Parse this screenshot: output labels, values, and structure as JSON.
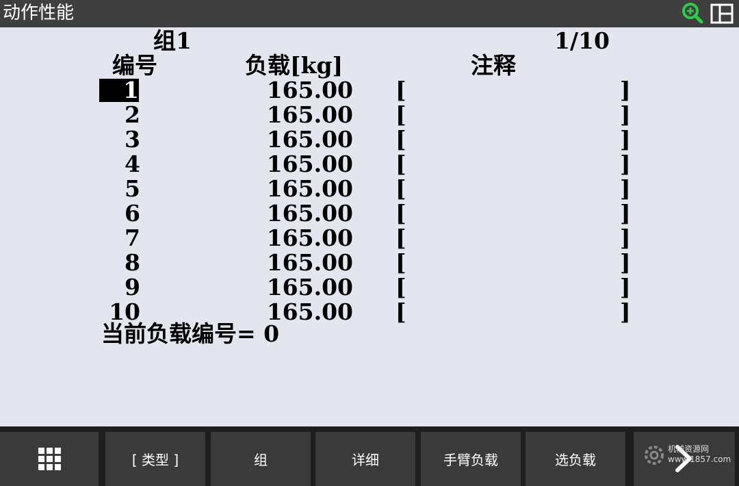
{
  "title": "动作性能",
  "icons": {
    "zoom": "zoom-in-icon",
    "layout": "split-layout-icon",
    "menu": "grid-menu-icon",
    "next": "next-page-icon"
  },
  "colors": {
    "titlebar_bg": "#3f3f3f",
    "content_bg": "#e3e6ee",
    "fkey_bg": "#3a3a3a",
    "zoom_icon": "#31c94a"
  },
  "group": "组1",
  "page_indicator": "1/10",
  "headers": {
    "number": "编号",
    "load": "负载[kg]",
    "comment": "注释"
  },
  "rows": [
    {
      "num": "1",
      "load": "165.00",
      "comment": ""
    },
    {
      "num": "2",
      "load": "165.00",
      "comment": ""
    },
    {
      "num": "3",
      "load": "165.00",
      "comment": ""
    },
    {
      "num": "4",
      "load": "165.00",
      "comment": ""
    },
    {
      "num": "5",
      "load": "165.00",
      "comment": ""
    },
    {
      "num": "6",
      "load": "165.00",
      "comment": ""
    },
    {
      "num": "7",
      "load": "165.00",
      "comment": ""
    },
    {
      "num": "8",
      "load": "165.00",
      "comment": ""
    },
    {
      "num": "9",
      "load": "165.00",
      "comment": ""
    },
    {
      "num": "10",
      "load": "165.00",
      "comment": ""
    }
  ],
  "bracket_open": "[",
  "bracket_close": "]",
  "current_load_label": "当前负载编号=",
  "current_load_value": "0",
  "fkeys": {
    "type": "[ 类型 ]",
    "group": "组",
    "detail": "详细",
    "arm_load": "手臂负载",
    "select_load": "选负载"
  },
  "watermark": {
    "line1": "机械资源网",
    "line2": "www.1857.com"
  }
}
